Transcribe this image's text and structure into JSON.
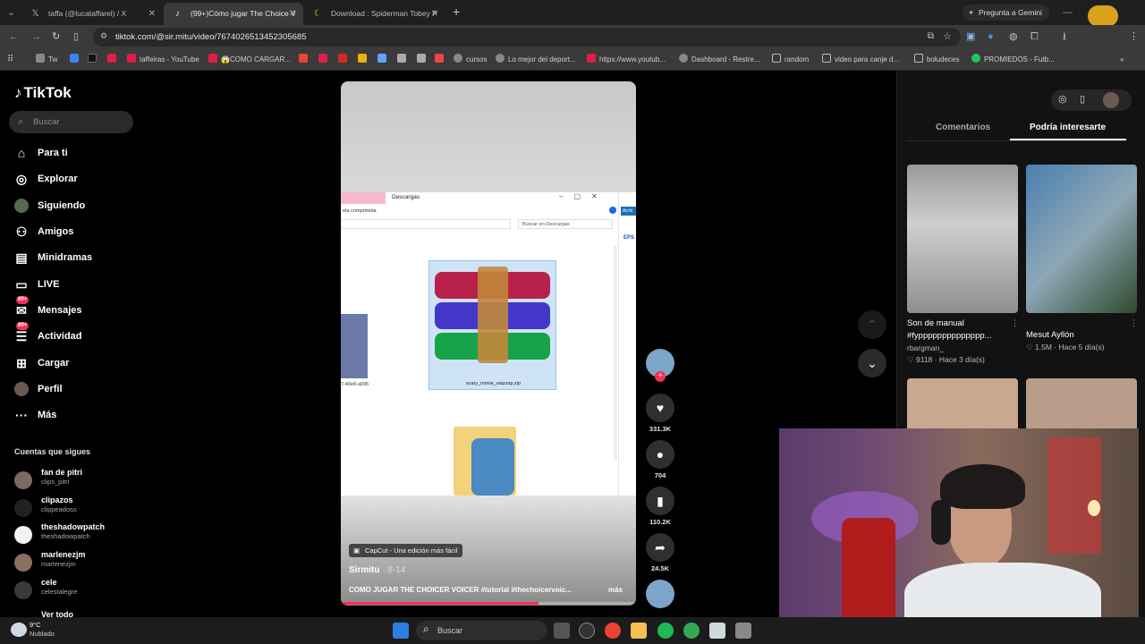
{
  "browser": {
    "tabs": [
      {
        "label": "taffa  (@lucataffarel) / X",
        "icon": "x-logo-icon"
      },
      {
        "label": "(99+)Cómo jugar The Choice V",
        "icon": "tiktok-icon"
      },
      {
        "label": "Download : Spiderman Tobey P",
        "icon": "moon-icon"
      }
    ],
    "gemini_label": "Pregunta a Gemini",
    "url": "tiktok.com/@sir.mitu/video/7674026513452305685",
    "bookmarks": [
      "Tw",
      "taffeiras - YouTube",
      "😱COMO CARGAR...",
      "cursos",
      "Lo mejor del deport...",
      "https://www.youtub...",
      "Dashboard - Restre...",
      "random",
      "video para canje d...",
      "boludeces",
      "PROMIEDOS - Futb..."
    ]
  },
  "tiktok": {
    "logo": "TikTok",
    "search_placeholder": "Buscar",
    "nav": [
      {
        "label": "Para ti",
        "icon": "home-icon"
      },
      {
        "label": "Explorar",
        "icon": "compass-icon"
      },
      {
        "label": "Siguiendo",
        "icon": "following-icon"
      },
      {
        "label": "Amigos",
        "icon": "friends-icon"
      },
      {
        "label": "Minidramas",
        "icon": "minidramas-icon"
      },
      {
        "label": "LIVE",
        "icon": "live-icon"
      },
      {
        "label": "Mensajes",
        "icon": "messages-icon",
        "badge": "99+"
      },
      {
        "label": "Actividad",
        "icon": "activity-icon",
        "badge": "99+"
      },
      {
        "label": "Cargar",
        "icon": "upload-icon"
      },
      {
        "label": "Perfil",
        "icon": "profile-icon"
      },
      {
        "label": "Más",
        "icon": "more-icon"
      }
    ],
    "following_title": "Cuentas que sigues",
    "following": [
      {
        "name": "fan de pitri",
        "handle": "clips_pitri"
      },
      {
        "name": "clipazos",
        "handle": "clippeadoss"
      },
      {
        "name": "theshadowpatch",
        "handle": "theshadowpatch"
      },
      {
        "name": "marlenezjm",
        "handle": "marlenezjm"
      },
      {
        "name": "cele",
        "handle": "celestalegre"
      }
    ],
    "see_all": "Ver todo"
  },
  "video": {
    "window_title": "Descargas",
    "window_left_text": "eta comprimida",
    "window_search": "Buscar en Descargas",
    "window_side_tag": "Archi",
    "window_side_text": "EPS",
    "file_name": "scary_movie_wazzap.zip",
    "file_left_label": "7-40e0-a095",
    "capcut_label": "CapCut - Una edición más fácil",
    "author": "Sirmitu",
    "date": "8-14",
    "description": "COMO JUGAR THE CHOICER VOICER #tutorial #thechoicervoic...",
    "more": "más",
    "progress": 0.67
  },
  "actions": {
    "likes": "331.3K",
    "comments": "704",
    "saves": "110.2K",
    "shares": "24.5K"
  },
  "panel": {
    "tabs": [
      "Comentarios",
      "Podría interesarte"
    ],
    "active_tab": 1,
    "cards": [
      {
        "title": "Son de manual #fypppppppppppppp...",
        "user": "rbargman_",
        "likes": "9118",
        "age": "Hace 3 día(s)"
      },
      {
        "title": "Mesut Ayllón",
        "user": "",
        "likes": "1.5M",
        "age": "Hace 5 día(s)"
      }
    ]
  },
  "taskbar": {
    "temperature": "9°C",
    "weather": "Nublado",
    "search_label": "Buscar"
  }
}
